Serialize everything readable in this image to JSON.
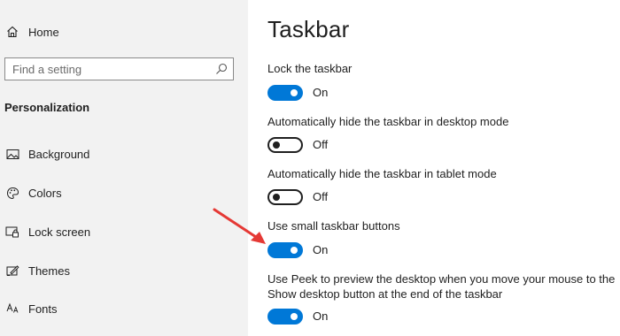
{
  "sidebar": {
    "home_label": "Home",
    "search_placeholder": "Find a setting",
    "section_title": "Personalization",
    "items": [
      {
        "label": "Background",
        "icon": "picture-icon"
      },
      {
        "label": "Colors",
        "icon": "palette-icon"
      },
      {
        "label": "Lock screen",
        "icon": "lock-screen-icon"
      },
      {
        "label": "Themes",
        "icon": "themes-icon"
      },
      {
        "label": "Fonts",
        "icon": "fonts-icon"
      }
    ]
  },
  "main": {
    "title": "Taskbar",
    "settings": [
      {
        "label": "Lock the taskbar",
        "state": "On"
      },
      {
        "label": "Automatically hide the taskbar in desktop mode",
        "state": "Off"
      },
      {
        "label": "Automatically hide the taskbar in tablet mode",
        "state": "Off"
      },
      {
        "label": "Use small taskbar buttons",
        "state": "On"
      },
      {
        "label_line1": "Use Peek to preview the desktop when you move your mouse to the",
        "label_line2": "Show desktop button at the end of the taskbar",
        "state": "On"
      }
    ]
  },
  "colors": {
    "accent": "#0078d7",
    "sidebar_bg": "#f2f2f2",
    "annotation_arrow": "#e53935"
  }
}
